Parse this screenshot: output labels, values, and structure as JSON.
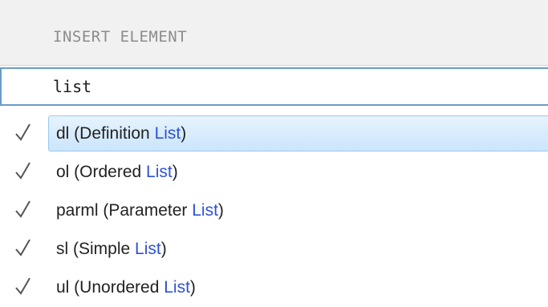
{
  "header": {
    "title": "INSERT ELEMENT"
  },
  "search": {
    "value": "list"
  },
  "colors": {
    "match_highlight": "#2f52d6",
    "selection_border": "#9ac9f0",
    "input_border": "#6a9cc6"
  },
  "results": [
    {
      "icon": "checkmark-icon",
      "prefix": "dl (Definition ",
      "match": "List",
      "suffix": ")",
      "selected": true
    },
    {
      "icon": "checkmark-icon",
      "prefix": "ol (Ordered ",
      "match": "List",
      "suffix": ")",
      "selected": false
    },
    {
      "icon": "checkmark-icon",
      "prefix": "parml (Parameter ",
      "match": "List",
      "suffix": ")",
      "selected": false
    },
    {
      "icon": "checkmark-icon",
      "prefix": "sl (Simple ",
      "match": "List",
      "suffix": ")",
      "selected": false
    },
    {
      "icon": "checkmark-icon",
      "prefix": "ul (Unordered ",
      "match": "List",
      "suffix": ")",
      "selected": false
    }
  ]
}
